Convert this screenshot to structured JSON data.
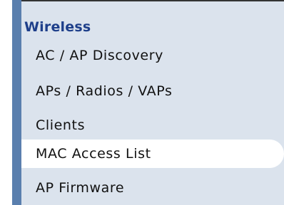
{
  "menu": {
    "section_title": "Wireless",
    "items": [
      {
        "label": "AC / AP Discovery"
      },
      {
        "label": "APs / Radios / VAPs"
      },
      {
        "label": "Clients"
      },
      {
        "label": "MAC Access List",
        "selected": true
      },
      {
        "label": "AP Firmware"
      }
    ]
  },
  "colors": {
    "panel_bg": "#dbe3ed",
    "left_bar": "#5a7fae",
    "header_text": "#1e3f8a",
    "selected_bg": "#ffffff"
  }
}
